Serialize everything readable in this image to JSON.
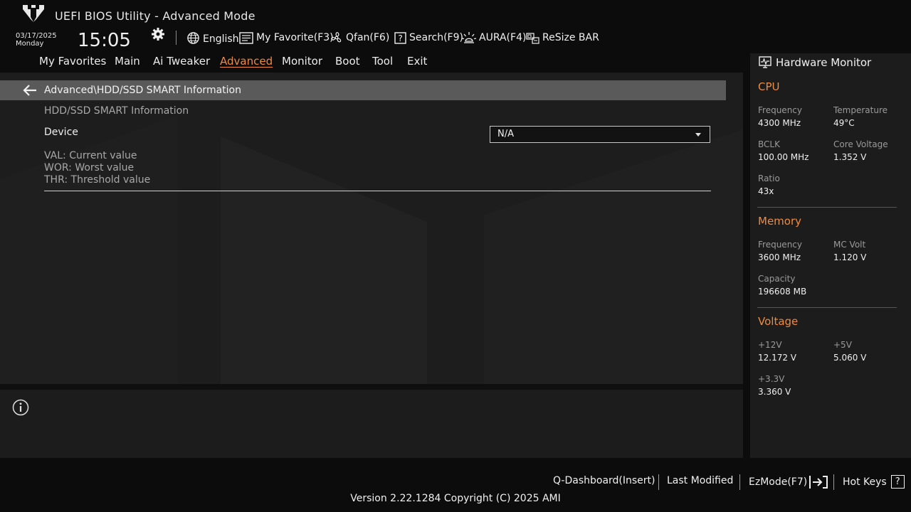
{
  "header": {
    "title": "UEFI BIOS Utility - Advanced Mode",
    "date": "03/17/2025",
    "weekday": "Monday",
    "time": "15:05",
    "toolbar": {
      "language": "English",
      "my_favorite": "My Favorite(F3)",
      "qfan": "Qfan(F6)",
      "search": "Search(F9)",
      "aura": "AURA(F4)",
      "resize_bar": "ReSize BAR"
    }
  },
  "nav": {
    "tabs": [
      "My Favorites",
      "Main",
      "Ai Tweaker",
      "Advanced",
      "Monitor",
      "Boot",
      "Tool",
      "Exit"
    ],
    "active_tab": "Advanced"
  },
  "page": {
    "breadcrumb": "Advanced\\HDD/SSD SMART Information",
    "section_label": "HDD/SSD SMART Information",
    "device_label": "Device",
    "device_value": "N/A",
    "legend": [
      "VAL:  Current value",
      "WOR: Worst value",
      "THR:  Threshold value"
    ]
  },
  "hardware_monitor": {
    "title": "Hardware Monitor",
    "cpu": {
      "title": "CPU",
      "frequency_label": "Frequency",
      "frequency_value": "4300 MHz",
      "temperature_label": "Temperature",
      "temperature_value": "49°C",
      "bclk_label": "BCLK",
      "bclk_value": "100.00 MHz",
      "core_voltage_label": "Core Voltage",
      "core_voltage_value": "1.352 V",
      "ratio_label": "Ratio",
      "ratio_value": "43x"
    },
    "memory": {
      "title": "Memory",
      "frequency_label": "Frequency",
      "frequency_value": "3600 MHz",
      "mc_volt_label": "MC Volt",
      "mc_volt_value": "1.120 V",
      "capacity_label": "Capacity",
      "capacity_value": "196608 MB"
    },
    "voltage": {
      "title": "Voltage",
      "v12_label": "+12V",
      "v12_value": "12.172 V",
      "v5_label": "+5V",
      "v5_value": "5.060 V",
      "v33_label": "+3.3V",
      "v33_value": "3.360 V"
    }
  },
  "footer": {
    "q_dashboard": "Q-Dashboard(Insert)",
    "last_modified": "Last Modified",
    "ezmode": "EzMode(F7)",
    "hot_keys": "Hot Keys",
    "hot_keys_icon_glyph": "?",
    "version": "Version 2.22.1284 Copyright (C) 2025 AMI"
  },
  "colors": {
    "accent": "#f08a3c",
    "header_bg": "#0c0c0c",
    "content_bg": "#1d1d1d",
    "breadcrumb_bg": "#5a5a5a"
  },
  "icons": [
    "tuf-logo",
    "gear-icon",
    "globe-icon",
    "favorite-icon",
    "fan-icon",
    "search-icon",
    "aura-icon",
    "resize-bar-icon",
    "back-arrow-icon",
    "info-icon",
    "hardware-monitor-icon",
    "ezmode-exit-icon",
    "help-icon"
  ]
}
